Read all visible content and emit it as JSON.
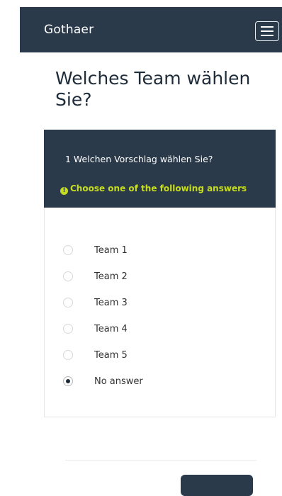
{
  "header": {
    "brand": "Gothaer"
  },
  "survey": {
    "title": "Welches Team wählen Sie?"
  },
  "question": {
    "text": "1 Welchen Vorschlag wählen Sie?",
    "help": "Choose one of the following answers",
    "help_icon": "info-icon"
  },
  "answers": [
    {
      "label": "Team 1",
      "selected": false
    },
    {
      "label": "Team 2",
      "selected": false
    },
    {
      "label": "Team 3",
      "selected": false
    },
    {
      "label": "Team 4",
      "selected": false
    },
    {
      "label": "Team 5",
      "selected": false
    },
    {
      "label": "No answer",
      "selected": true
    }
  ],
  "colors": {
    "header_bg": "#2b3a4b",
    "help_text": "#c6dc1f"
  }
}
